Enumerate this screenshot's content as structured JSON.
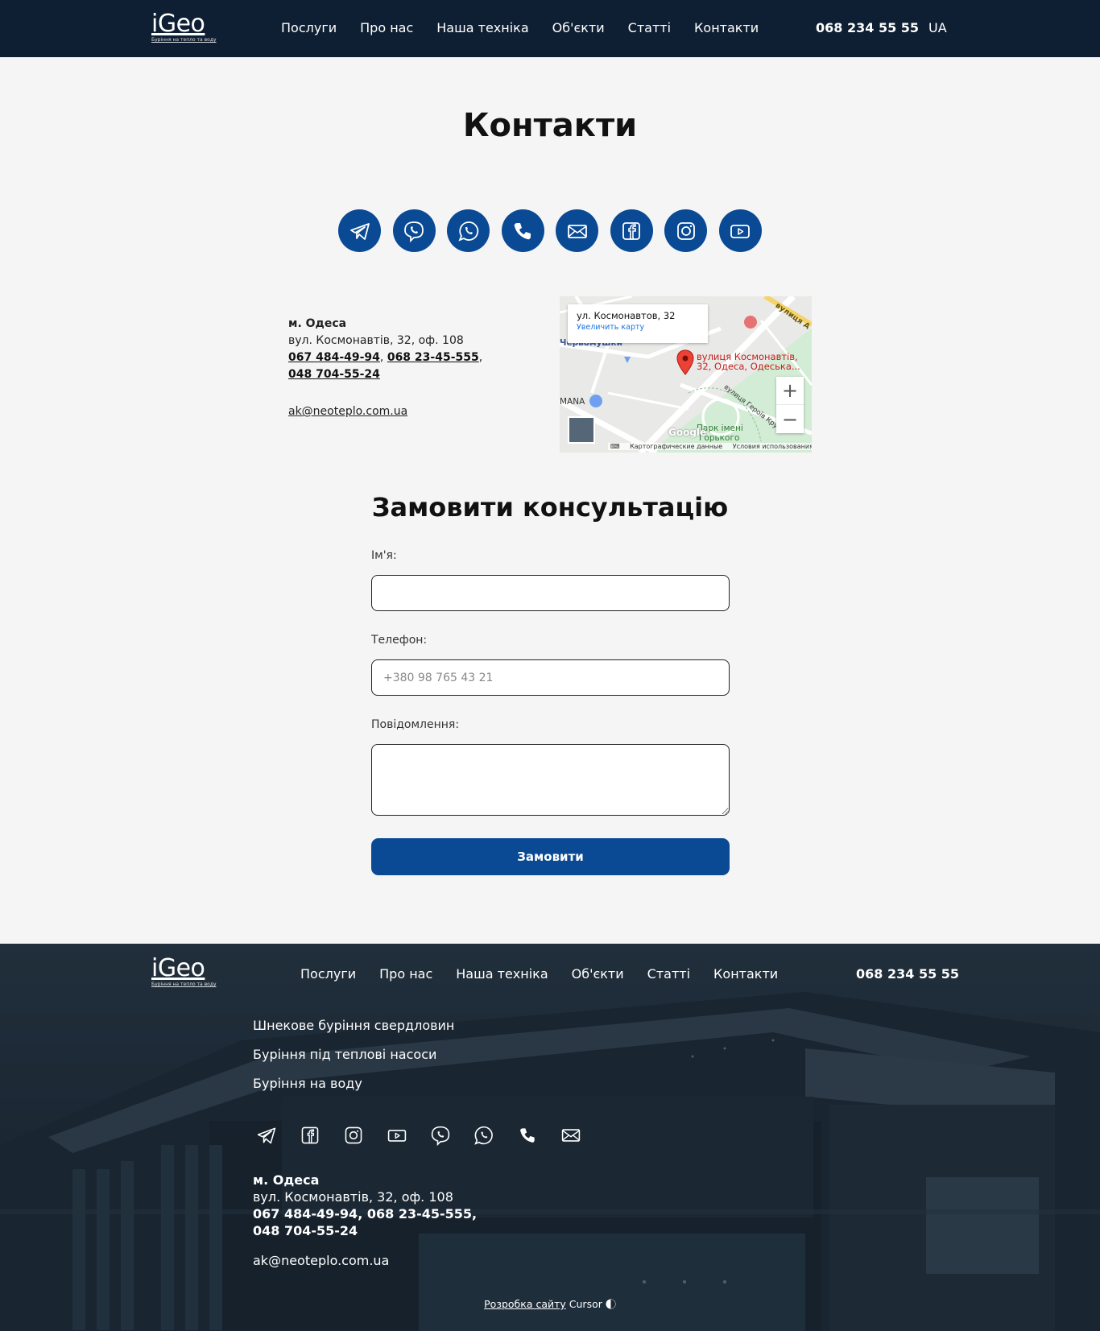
{
  "brand": {
    "logo_word": "iGeo",
    "logo_tagline": "Буріння на тепло та воду"
  },
  "header": {
    "nav": [
      "Послуги",
      "Про нас",
      "Наша техніка",
      "Об'єкти",
      "Статті",
      "Контакти"
    ],
    "phone": "068 234 55 55",
    "language": "UA"
  },
  "page": {
    "title": "Контакти"
  },
  "socials_top": [
    "telegram-icon",
    "viber-icon",
    "whatsapp-icon",
    "phone-icon",
    "mail-icon",
    "facebook-icon",
    "instagram-icon",
    "youtube-icon"
  ],
  "contact": {
    "city": "м. Одеса",
    "address": "вул. Космонавтів, 32, оф. 108",
    "phone_1": "067 484-49-94",
    "phone_2": "068 23-45-555",
    "phone_3": "048 704-55-24",
    "separator_1": ", ",
    "separator_2": ",",
    "email": "ak@neoteplo.com.ua"
  },
  "map": {
    "info_address": "ул. Космонавтов, 32",
    "info_enlarge": "Увеличить карту",
    "pin_label_line1": "вулиця Космонавтів,",
    "pin_label_line2": "32, Одеса, Одеська...",
    "place_1": "Черьомушки",
    "place_2": "MANA",
    "place_3": "Парк імені",
    "place_4": "Горького",
    "street_1": "вулиця Героїв Крут",
    "street_2": "вулиця А",
    "google": "Google",
    "footer_data": "Картографические данные",
    "footer_terms": "Условия использования",
    "zoom_in": "+",
    "zoom_out": "−"
  },
  "form": {
    "title": "Замовити консультацію",
    "name_label": "Ім'я:",
    "name_value": "",
    "phone_label": "Телефон:",
    "phone_placeholder": "+380 98 765 43 21",
    "message_label": "Повідомлення:",
    "message_value": "",
    "submit_label": "Замовити"
  },
  "footer": {
    "nav": [
      "Послуги",
      "Про нас",
      "Наша техніка",
      "Об'єкти",
      "Статті",
      "Контакти"
    ],
    "phone": "068 234 55 55",
    "services": [
      "Шнекове буріння свердловин",
      "Буріння під теплові насоси",
      "Буріння на воду"
    ],
    "socials": [
      "telegram-icon",
      "facebook-icon",
      "instagram-icon",
      "youtube-icon",
      "viber-icon",
      "whatsapp-icon",
      "phone-icon",
      "mail-icon"
    ],
    "credit_link": "Розробка сайту",
    "credit_brand": "Cursor"
  },
  "colors": {
    "header_bg": "#0f1f33",
    "accent": "#0a4a94",
    "page_bg": "#f5f5f5",
    "map_pin": "#ea4335"
  }
}
